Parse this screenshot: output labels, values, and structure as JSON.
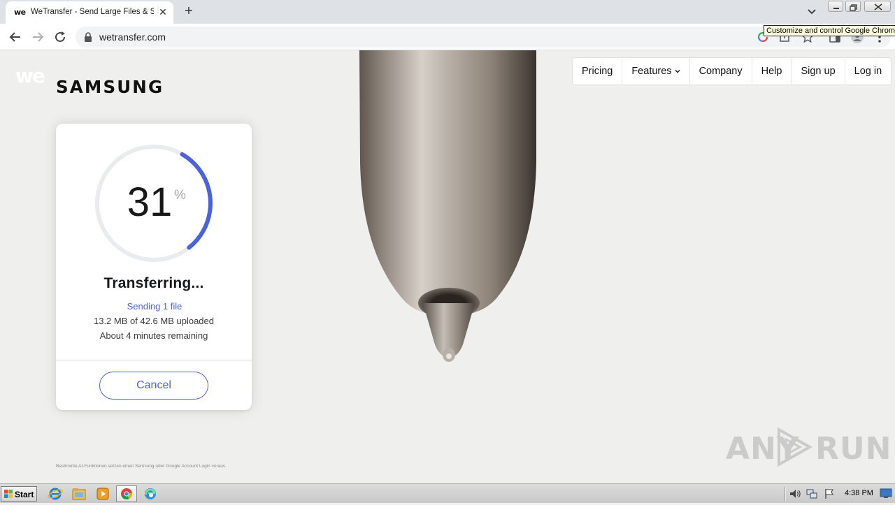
{
  "browser": {
    "tab": {
      "favicon_text": "we",
      "title": "WeTransfer - Send Large Files & Sha",
      "close_symbol": "✕"
    },
    "new_tab_symbol": "+",
    "address": {
      "url": "wetransfer.com"
    },
    "tooltip": "Customize and control Google Chrome"
  },
  "page": {
    "brand": {
      "logo_text": "we",
      "partner": "SAMSUNG"
    },
    "nav": {
      "items": [
        "Pricing",
        "Features",
        "Company",
        "Help",
        "Sign up",
        "Log in"
      ]
    },
    "transfer": {
      "percent": "31",
      "percent_value": 0.31,
      "percent_unit": "%",
      "status": "Transferring...",
      "sending": "Sending 1 file",
      "uploaded": "13.2 MB of 42.6 MB uploaded",
      "remaining": "About 4 minutes remaining",
      "cancel_label": "Cancel",
      "accent_color": "#4b62e0"
    },
    "disclaimer": "Bestimmte AI-Funktionen setzen einen Samsung oder Google Account Login voraus.",
    "watermark": {
      "left": "ANY",
      "right": "RUN"
    }
  },
  "taskbar": {
    "start_label": "Start",
    "clock": "4:38 PM"
  }
}
